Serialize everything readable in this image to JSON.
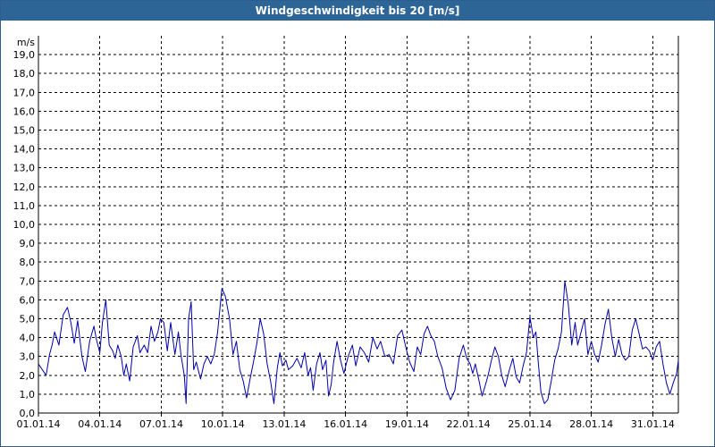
{
  "window": {
    "title": "Windgeschwindigkeit bis 20 [m/s]"
  },
  "colors": {
    "titlebar": "#2c6596",
    "series": "#0000aa",
    "grid": "#000000"
  },
  "chart_data": {
    "type": "line",
    "title": "Windgeschwindigkeit bis 20 [m/s]",
    "ylabel": "m/s",
    "ylim": [
      0,
      20
    ],
    "xlim": [
      "01.01.14",
      "01.02.14 06:00"
    ],
    "y_ticks": [
      "0,0",
      "1,0",
      "2,0",
      "3,0",
      "4,0",
      "5,0",
      "6,0",
      "7,0",
      "8,0",
      "9,0",
      "10,0",
      "11,0",
      "12,0",
      "13,0",
      "14,0",
      "15,0",
      "16,0",
      "17,0",
      "18,0",
      "19,0"
    ],
    "x_ticks": [
      "01.01.14",
      "04.01.14",
      "07.01.14",
      "10.01.14",
      "13.01.14",
      "16.01.14",
      "19.01.14",
      "22.01.14",
      "25.01.14",
      "28.01.14",
      "31.01.14"
    ],
    "grid": true,
    "legend": "none",
    "series": [
      {
        "x": [
          "01.01.14 00:00",
          "01.01.14 09:00",
          "01.01.14 13:00",
          "01.01.14 16:00",
          "01.01.14 19:00",
          "02.01.14 00:00",
          "02.01.14 05:00",
          "02.01.14 10:00",
          "02.01.14 14:00",
          "02.01.14 18:00",
          "02.01.14 22:00",
          "03.01.14 03:00",
          "03.01.14 07:00",
          "03.01.14 12:00",
          "03.01.14 17:00",
          "03.01.14 20:00",
          "04.01.14 00:00",
          "04.01.14 03:00",
          "04.01.14 07:00",
          "04.01.14 11:00",
          "04.01.14 15:00",
          "04.01.14 18:00",
          "04.01.14 21:00",
          "05.01.14 01:00",
          "05.01.14 04:00",
          "05.01.14 07:00",
          "05.01.14 11:00",
          "05.01.14 15:00",
          "05.01.14 20:00",
          "05.01.14 23:00",
          "06.01.14 04:00",
          "06.01.14 08:00",
          "06.01.14 12:00",
          "06.01.14 16:00",
          "06.01.14 20:00",
          "06.01.14 23:00",
          "07.01.14 03:00",
          "07.01.14 07:00",
          "07.01.14 11:00",
          "07.01.14 16:00",
          "07.01.14 20:00",
          "07.01.14 23:00",
          "08.01.14 03:00",
          "08.01.14 05:00",
          "08.01.14 08:00",
          "08.01.14 11:00",
          "08.01.14 14:00",
          "08.01.14 17:00",
          "08.01.14 22:00",
          "09.01.14 02:00",
          "09.01.14 06:00",
          "09.01.14 10:00",
          "09.01.14 14:00",
          "09.01.14 18:00",
          "09.01.14 23:00",
          "10.01.14 03:00",
          "10.01.14 08:00",
          "10.01.14 12:00",
          "10.01.14 16:00",
          "10.01.14 20:00",
          "11.01.14 00:00",
          "11.01.14 04:00",
          "11.01.14 08:00",
          "11.01.14 12:00",
          "11.01.14 16:00",
          "11.01.14 20:00",
          "12.01.14 00:00",
          "12.01.14 04:00",
          "12.01.14 08:00",
          "12.01.14 12:00",
          "12.01.14 16:00",
          "12.01.14 19:00",
          "12.01.14 22:00",
          "13.01.14 02:00",
          "13.01.14 05:00",
          "13.01.14 10:00",
          "13.01.14 15:00",
          "13.01.14 20:00",
          "14.01.14 00:00",
          "14.01.14 04:00",
          "14.01.14 07:00",
          "14.01.14 10:00",
          "14.01.14 14:00",
          "14.01.14 18:00",
          "14.01.14 21:00",
          "15.01.14 01:00",
          "15.01.14 04:00",
          "15.01.14 07:00",
          "15.01.14 10:00",
          "15.01.14 14:00",
          "15.01.14 18:00",
          "15.01.14 22:00",
          "16.01.14 03:00",
          "16.01.14 08:00",
          "16.01.14 12:00",
          "16.01.14 17:00",
          "16.01.14 22:00",
          "17.01.14 03:00",
          "17.01.14 08:00",
          "17.01.14 13:00",
          "17.01.14 17:00",
          "17.01.14 22:00",
          "18.01.14 03:00",
          "18.01.14 08:00",
          "18.01.14 13:00",
          "18.01.14 18:00",
          "18.01.14 23:00",
          "19.01.14 03:00",
          "19.01.14 08:00",
          "19.01.14 12:00",
          "19.01.14 16:00",
          "19.01.14 20:00",
          "20.01.14 00:00",
          "20.01.14 04:00",
          "20.01.14 08:00",
          "20.01.14 12:00",
          "20.01.14 17:00",
          "20.01.14 22:00",
          "21.01.14 03:00",
          "21.01.14 08:00",
          "21.01.14 13:00",
          "21.01.14 18:00",
          "21.01.14 22:00",
          "22.01.14 02:00",
          "22.01.14 05:00",
          "22.01.14 08:00",
          "22.01.14 12:00",
          "22.01.14 16:00",
          "22.01.14 20:00",
          "22.01.14 23:00",
          "23.01.14 03:00",
          "23.01.14 07:00",
          "23.01.14 11:00",
          "23.01.14 15:00",
          "23.01.14 19:00",
          "24.01.14 00:00",
          "24.01.14 04:00",
          "24.01.14 08:00",
          "24.01.14 12:00",
          "24.01.14 16:00",
          "24.01.14 20:00",
          "25.01.14 00:00",
          "25.01.14 04:00",
          "25.01.14 07:00",
          "25.01.14 10:00",
          "25.01.14 13:00",
          "25.01.14 17:00",
          "25.01.14 21:00",
          "26.01.14 01:00",
          "26.01.14 05:00",
          "26.01.14 09:00",
          "26.01.14 13:00",
          "26.01.14 17:00",
          "26.01.14 21:00",
          "27.01.14 01:00",
          "27.01.14 05:00",
          "27.01.14 08:00",
          "27.01.14 12:00",
          "27.01.14 16:00",
          "27.01.14 20:00",
          "28.01.14 00:00",
          "28.01.14 04:00",
          "28.01.14 08:00",
          "28.01.14 12:00",
          "28.01.14 16:00",
          "28.01.14 20:00",
          "29.01.14 00:00",
          "29.01.14 04:00",
          "29.01.14 08:00",
          "29.01.14 12:00",
          "29.01.14 16:00",
          "29.01.14 20:00",
          "30.01.14 00:00",
          "30.01.14 04:00",
          "30.01.14 08:00",
          "30.01.14 12:00",
          "30.01.14 16:00",
          "30.01.14 20:00",
          "31.01.14 00:00",
          "31.01.14 04:00",
          "31.01.14 08:00",
          "31.01.14 12:00",
          "31.01.14 16:00",
          "31.01.14 20:00",
          "01.02.14 00:00",
          "01.02.14 04:00",
          "01.02.14 06:00"
        ],
        "y": [
          2.6,
          2.0,
          3.1,
          3.6,
          4.3,
          3.6,
          5.2,
          5.6,
          4.8,
          3.7,
          4.9,
          3.0,
          2.2,
          3.8,
          4.6,
          3.9,
          3.2,
          4.8,
          6.0,
          3.6,
          3.3,
          2.9,
          3.6,
          3.0,
          2.0,
          2.6,
          1.7,
          3.5,
          4.1,
          3.2,
          3.6,
          3.2,
          4.6,
          3.8,
          4.3,
          5.0,
          4.8,
          3.3,
          4.8,
          3.1,
          4.3,
          3.1,
          2.0,
          0.5,
          5.0,
          5.9,
          2.3,
          2.7,
          1.8,
          2.6,
          3.0,
          2.6,
          3.1,
          4.3,
          6.6,
          6.2,
          5.0,
          3.1,
          3.8,
          2.3,
          1.7,
          0.8,
          1.8,
          2.7,
          3.7,
          5.0,
          4.2,
          2.6,
          1.7,
          0.5,
          2.4,
          3.2,
          2.5,
          2.8,
          2.3,
          2.5,
          2.9,
          2.4,
          3.2,
          2.0,
          2.4,
          1.2,
          2.6,
          3.2,
          2.3,
          2.8,
          0.9,
          1.5,
          2.7,
          3.8,
          2.8,
          2.1,
          3.0,
          3.6,
          2.5,
          3.5,
          3.2,
          2.7,
          4.0,
          3.4,
          3.8,
          3.0,
          3.1,
          2.6,
          4.1,
          4.4,
          3.4,
          2.7,
          2.2,
          3.5,
          3.1,
          4.2,
          4.6,
          4.1,
          3.8,
          3.0,
          2.4,
          1.3,
          0.7,
          1.2,
          2.9,
          3.6,
          2.9,
          2.6,
          2.1,
          2.6,
          1.8,
          0.9,
          1.5,
          2.0,
          2.8,
          3.5,
          3.0,
          2.0,
          1.4,
          2.3,
          2.9,
          1.9,
          1.6,
          2.5,
          3.2,
          5.1,
          4.0,
          4.3,
          2.6,
          1.1,
          0.5,
          0.7,
          1.7,
          2.8,
          3.4,
          4.3,
          7.0,
          5.8,
          3.6,
          4.8,
          3.6,
          4.3,
          5.0,
          3.1,
          3.8,
          3.1,
          2.7,
          3.6,
          4.7,
          5.5,
          4.0,
          3.0,
          3.9,
          3.1,
          2.8,
          3.0,
          4.4,
          5.0,
          4.2,
          3.4,
          3.5,
          3.3,
          2.8,
          3.5,
          3.8,
          2.6,
          1.6,
          1.0,
          1.6,
          2.1,
          2.8
        ]
      }
    ]
  }
}
